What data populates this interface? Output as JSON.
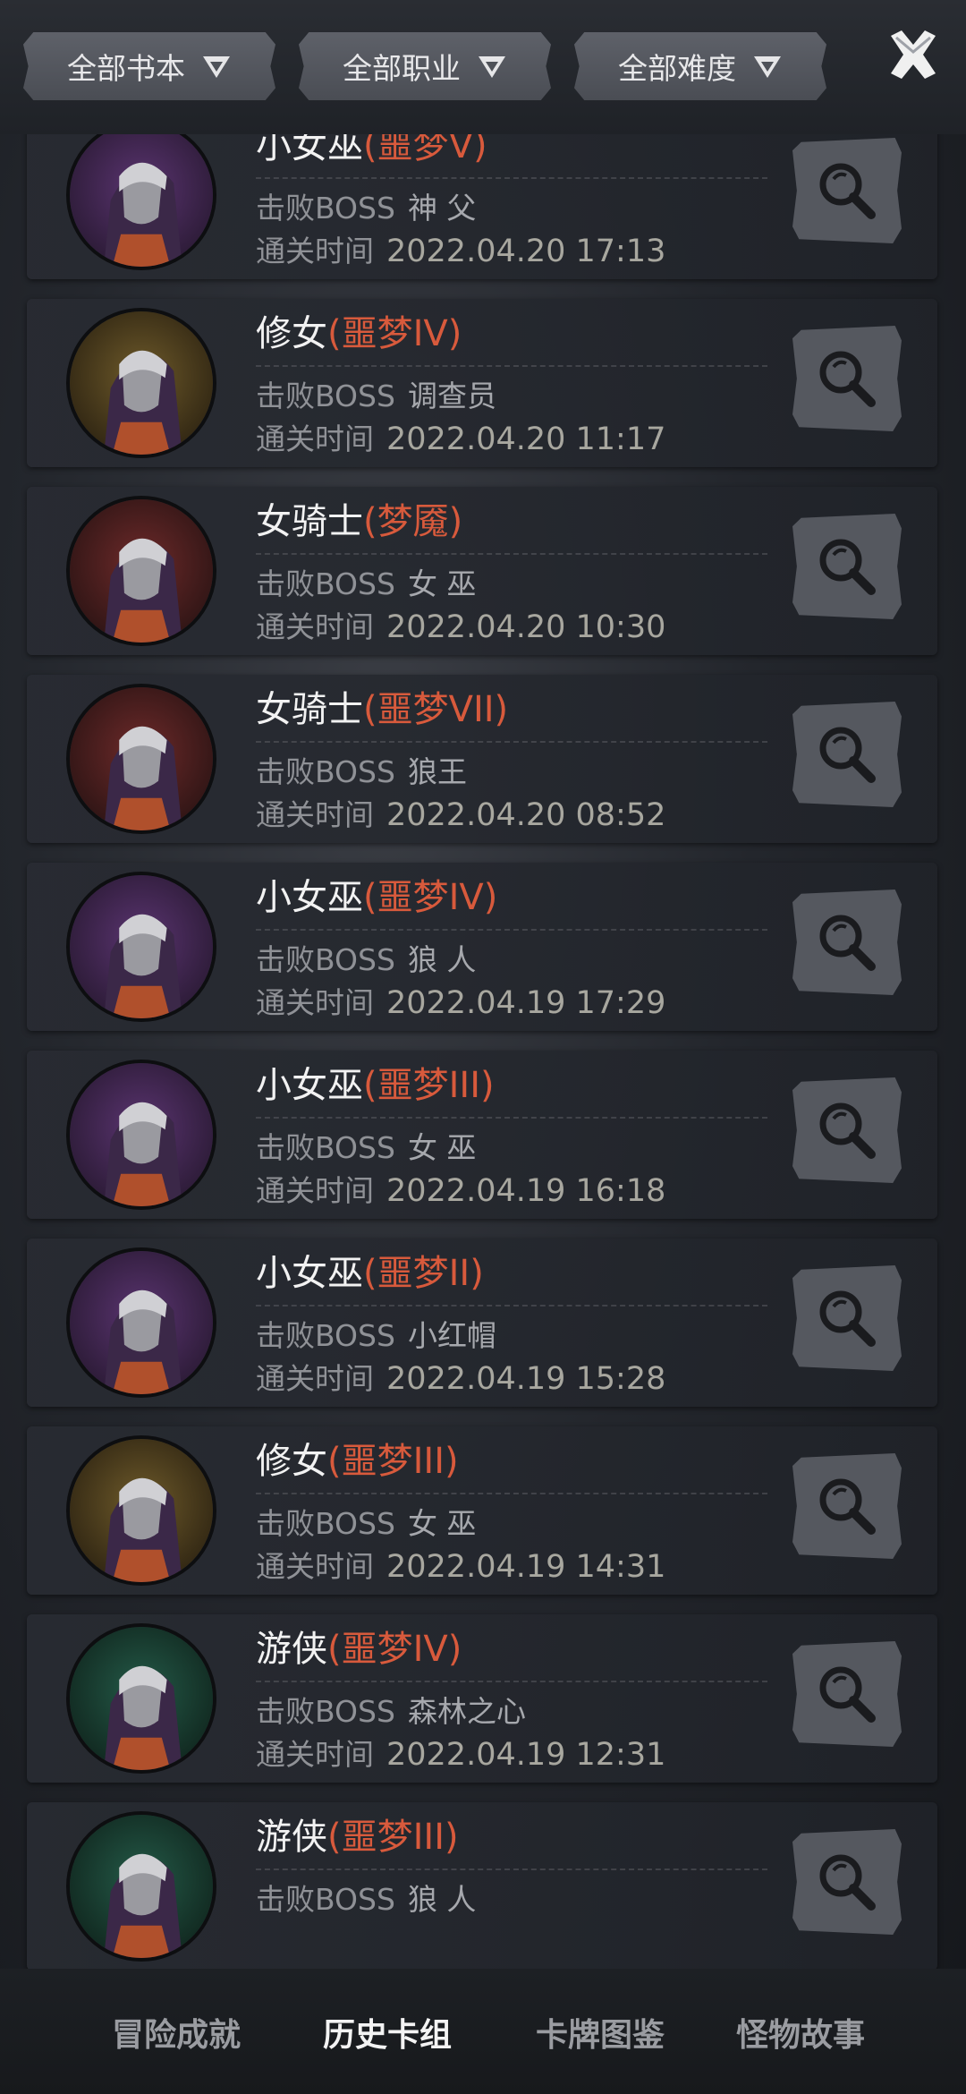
{
  "filters": [
    {
      "label": "全部书本"
    },
    {
      "label": "全部职业"
    },
    {
      "label": "全部难度"
    }
  ],
  "labels": {
    "boss": "击败BOSS",
    "time": "通关时间"
  },
  "records": [
    {
      "character": "小女巫",
      "difficulty": "(噩梦V)",
      "boss": "神 父",
      "time": "2022.04.20 17:13",
      "portrait": "witch"
    },
    {
      "character": "修女",
      "difficulty": "(噩梦IV)",
      "boss": "调查员",
      "time": "2022.04.20 11:17",
      "portrait": "nun"
    },
    {
      "character": "女骑士",
      "difficulty": "(梦魇)",
      "boss": "女 巫",
      "time": "2022.04.20 10:30",
      "portrait": "knight"
    },
    {
      "character": "女骑士",
      "difficulty": "(噩梦VII)",
      "boss": "狼王",
      "time": "2022.04.20 08:52",
      "portrait": "knight"
    },
    {
      "character": "小女巫",
      "difficulty": "(噩梦IV)",
      "boss": "狼 人",
      "time": "2022.04.19 17:29",
      "portrait": "witch"
    },
    {
      "character": "小女巫",
      "difficulty": "(噩梦III)",
      "boss": "女 巫",
      "time": "2022.04.19 16:18",
      "portrait": "witch"
    },
    {
      "character": "小女巫",
      "difficulty": "(噩梦II)",
      "boss": "小红帽",
      "time": "2022.04.19 15:28",
      "portrait": "witch"
    },
    {
      "character": "修女",
      "difficulty": "(噩梦III)",
      "boss": "女 巫",
      "time": "2022.04.19 14:31",
      "portrait": "nun"
    },
    {
      "character": "游侠",
      "difficulty": "(噩梦IV)",
      "boss": "森林之心",
      "time": "2022.04.19 12:31",
      "portrait": "ranger"
    },
    {
      "character": "游侠",
      "difficulty": "(噩梦III)",
      "boss": "狼 人",
      "time": "",
      "portrait": "ranger"
    }
  ],
  "tabs": [
    {
      "label": "冒险成就",
      "active": false
    },
    {
      "label": "历史卡组",
      "active": true
    },
    {
      "label": "卡牌图鉴",
      "active": false
    },
    {
      "label": "怪物故事",
      "active": false
    }
  ],
  "colors": {
    "difficulty": "#d85a3c",
    "witch_bg": "#4a2a5c",
    "nun_bg": "#5c4a22",
    "knight_bg": "#5c2424",
    "ranger_bg": "#1f4a3c"
  },
  "icons": {
    "filter_arrow": "filter-arrow-icon",
    "close": "close-icon",
    "view": "magnifier-icon"
  }
}
